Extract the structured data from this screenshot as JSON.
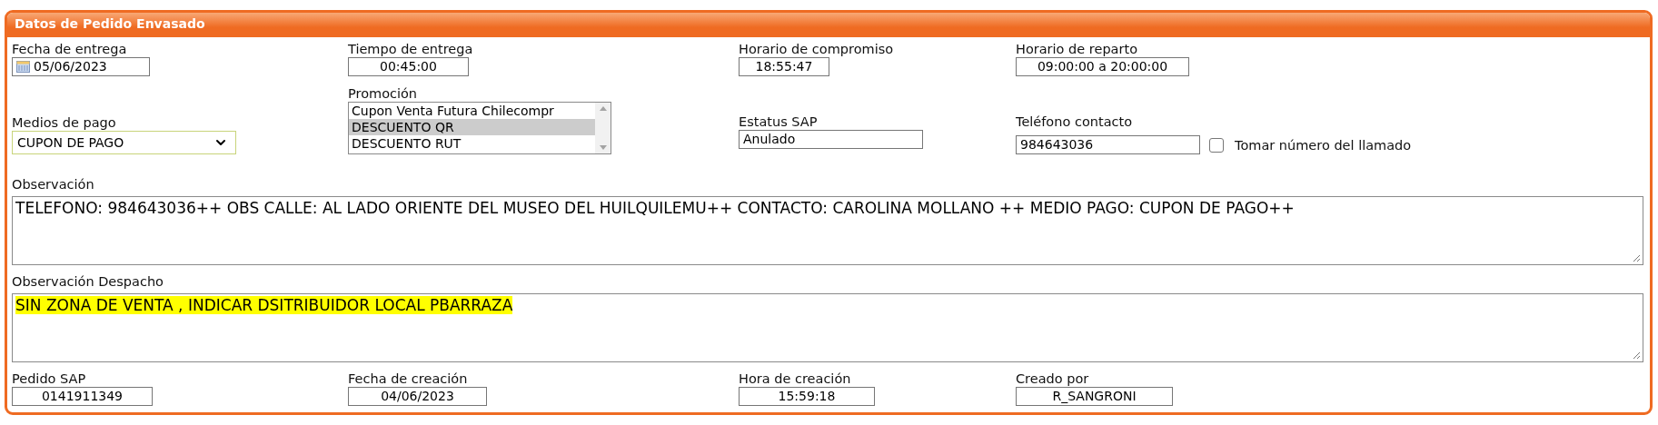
{
  "panel": {
    "title": "Datos de Pedido Envasado"
  },
  "delivery_date": {
    "label": "Fecha de entrega",
    "value": "05/06/2023"
  },
  "delivery_time": {
    "label": "Tiempo de entrega",
    "value": "00:45:00"
  },
  "commitment_time": {
    "label": "Horario de compromiso",
    "value": "18:55:47"
  },
  "delivery_window": {
    "label": "Horario de reparto",
    "value": "09:00:00 a 20:00:00"
  },
  "payment_method": {
    "label": "Medios de pago",
    "value": "CUPON DE PAGO"
  },
  "promotion": {
    "label": "Promoción",
    "options": [
      {
        "label": "Cupon Venta Futura Chilecompr",
        "selected": false
      },
      {
        "label": "DESCUENTO QR",
        "selected": true
      },
      {
        "label": "DESCUENTO RUT",
        "selected": false
      }
    ]
  },
  "sap_status": {
    "label": "Estatus SAP",
    "value": "Anulado"
  },
  "contact_phone": {
    "label": "Teléfono contacto",
    "value": "984643036",
    "use_caller_number": {
      "label": "Tomar número del llamado",
      "checked": false
    }
  },
  "observation": {
    "label": "Observación",
    "value": "TELEFONO: 984643036++ OBS CALLE: AL LADO ORIENTE DEL MUSEO DEL HUILQUILEMU++ CONTACTO: CAROLINA MOLLANO ++ MEDIO PAGO: CUPON DE PAGO++",
    "highlighted": false
  },
  "dispatch_observation": {
    "label": "Observación Despacho",
    "value": "SIN ZONA DE VENTA , INDICAR DSITRIBUIDOR LOCAL PBARRAZA",
    "highlighted": true
  },
  "sap_order": {
    "label": "Pedido SAP",
    "value": "0141911349"
  },
  "creation_date": {
    "label": "Fecha de creación",
    "value": "04/06/2023"
  },
  "creation_time": {
    "label": "Hora de creación",
    "value": "15:59:18"
  },
  "created_by": {
    "label": "Creado por",
    "value": "R_SANGRONI"
  }
}
